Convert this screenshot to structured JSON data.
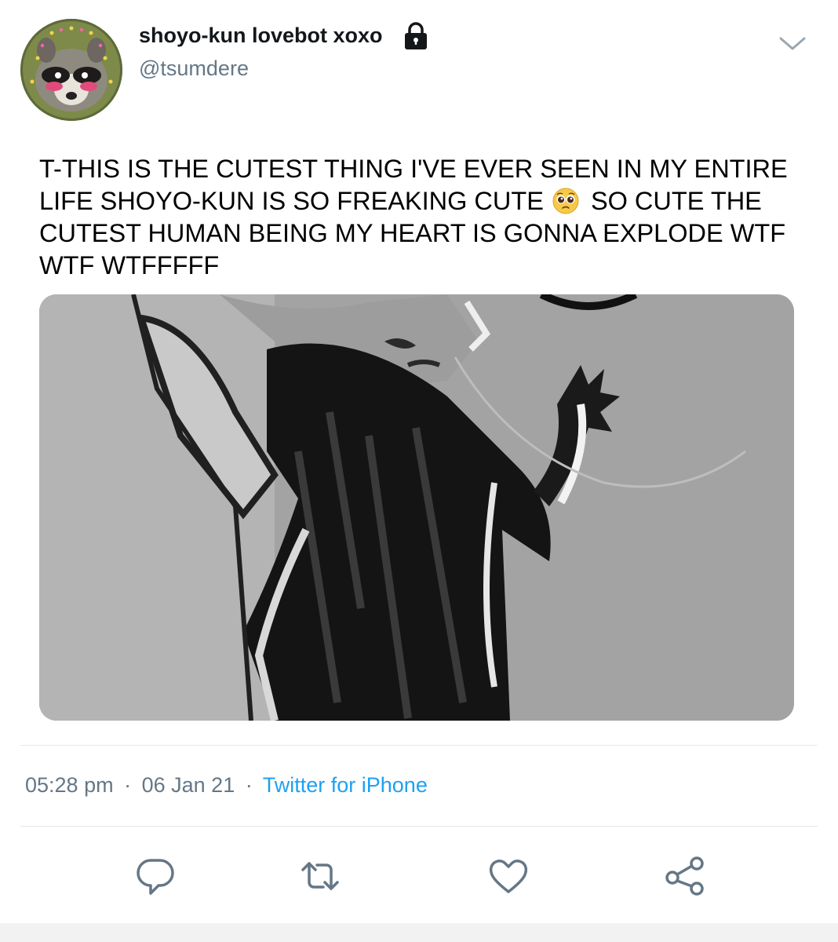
{
  "user": {
    "display_name": "shoyo-kun lovebot xoxo",
    "handle": "@tsumdere",
    "protected_icon": "lock-icon",
    "avatar": "raccoon-avatar"
  },
  "tweet": {
    "text_before_emoji": "T-THIS IS THE CUTEST THING I'VE EVER SEEN IN MY ENTIRE LIFE SHOYO-KUN IS SO FREAKING CUTE",
    "emoji": "pleading-face-emoji",
    "text_after_emoji": "SO CUTE THE CUTEST HUMAN BEING MY HEART IS GONNA EXPLODE WTF WTF WTFFFFF",
    "media": "grayscale-manga-illustration"
  },
  "meta": {
    "time": "05:28 pm",
    "separator": "·",
    "date": "06 Jan 21",
    "source": "Twitter for iPhone"
  },
  "actions": [
    "reply-icon",
    "retweet-icon",
    "like-icon",
    "share-icon"
  ],
  "colors": {
    "secondary_text": "#657786",
    "link": "#1da1f2",
    "divider": "#e1e8ed",
    "action_icon": "#657786"
  }
}
